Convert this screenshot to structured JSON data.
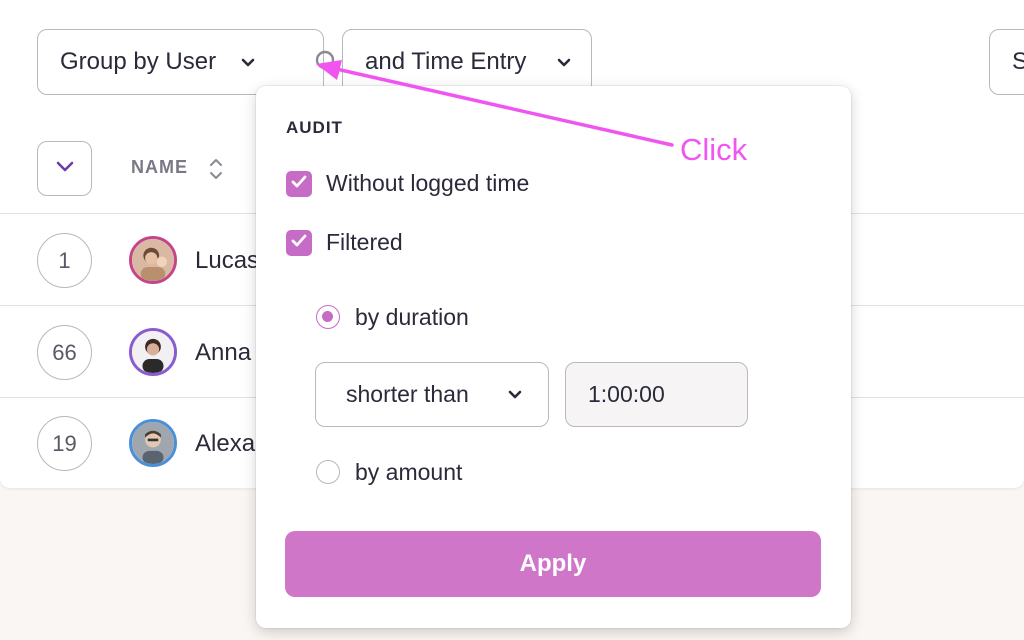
{
  "toolbar": {
    "group_by": "Group by User",
    "time_entry": "and Time Entry",
    "right_dropdown": "S"
  },
  "table": {
    "name_header": "NAME",
    "rows": [
      {
        "count": "1",
        "name": "Lucas"
      },
      {
        "count": "66",
        "name": "Anna"
      },
      {
        "count": "19",
        "name": "Alexa"
      }
    ]
  },
  "popover": {
    "title": "AUDIT",
    "without_logged_time": "Without logged time",
    "filtered": "Filtered",
    "by_duration": "by duration",
    "comparison": "shorter than",
    "duration_value": "1:00:00",
    "by_amount": "by amount",
    "apply": "Apply"
  },
  "annotation": {
    "label": "Click",
    "color": "#f055f0"
  },
  "colors": {
    "accent": "#c66bc6",
    "apply_button": "#cf76c9",
    "border": "#b9b7c1"
  },
  "icons": {
    "chevron": "chevron-down-icon",
    "search": "search-icon",
    "sort": "sort-icon",
    "check": "check-icon"
  }
}
